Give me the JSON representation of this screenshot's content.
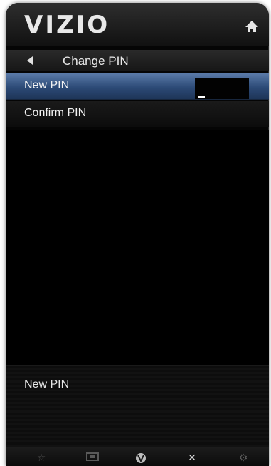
{
  "header": {
    "logo": "VIZIO"
  },
  "breadcrumb": {
    "title": "Change PIN"
  },
  "menu": {
    "items": [
      {
        "label": "New PIN",
        "selected": true
      },
      {
        "label": "Confirm PIN",
        "selected": false
      }
    ]
  },
  "help": {
    "text": "New PIN"
  },
  "bottom_bar": {
    "buttons": [
      "star-icon",
      "screen-icon",
      "vizio-v-icon",
      "close-icon",
      "gear-icon"
    ]
  },
  "colors": {
    "accent_selected": "#2c4a76",
    "background": "#050505",
    "text": "#f2f2f2"
  }
}
